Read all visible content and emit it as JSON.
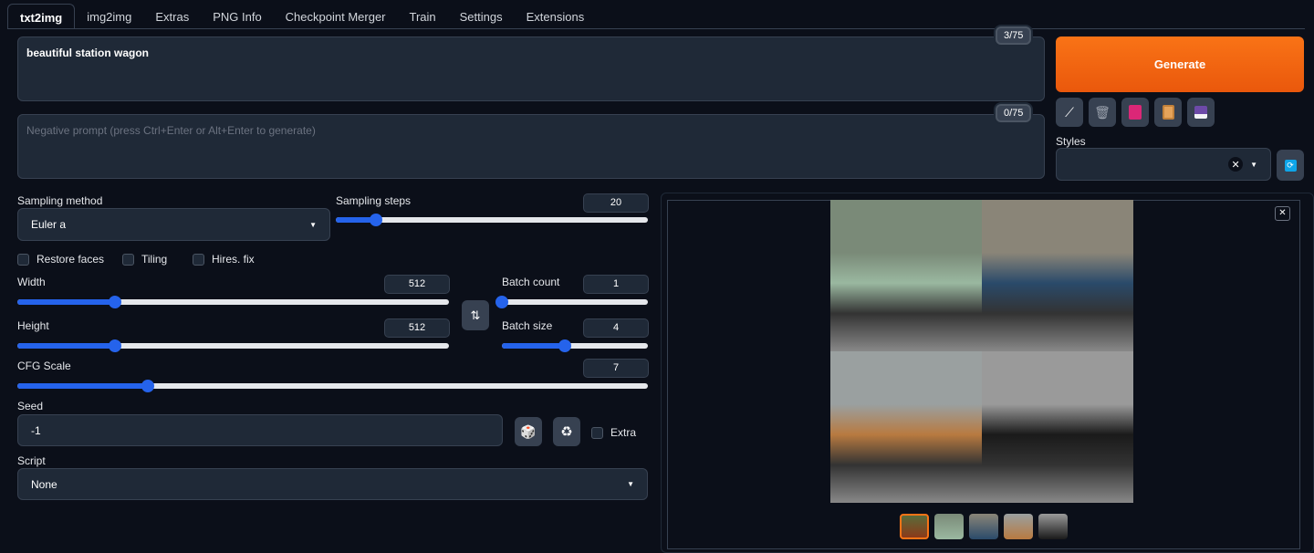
{
  "tabs": [
    "txt2img",
    "img2img",
    "Extras",
    "PNG Info",
    "Checkpoint Merger",
    "Train",
    "Settings",
    "Extensions"
  ],
  "prompt": {
    "value": "beautiful station wagon",
    "counter": "3/75"
  },
  "negative_prompt": {
    "placeholder": "Negative prompt (press Ctrl+Enter or Alt+Enter to generate)",
    "counter": "0/75"
  },
  "generate_label": "Generate",
  "tool_buttons": [
    "pencil-icon",
    "trash-icon",
    "picture-icon",
    "clipboard-icon",
    "save-icon"
  ],
  "styles": {
    "label": "Styles",
    "value": ""
  },
  "sampling_method": {
    "label": "Sampling method",
    "value": "Euler a"
  },
  "sampling_steps": {
    "label": "Sampling steps",
    "value": "20",
    "min": 1,
    "max": 150
  },
  "checkboxes": [
    "Restore faces",
    "Tiling",
    "Hires. fix"
  ],
  "width": {
    "label": "Width",
    "value": "512",
    "min": 64,
    "max": 2048
  },
  "height": {
    "label": "Height",
    "value": "512",
    "min": 64,
    "max": 2048
  },
  "batch_count": {
    "label": "Batch count",
    "value": "1",
    "min": 1,
    "max": 100
  },
  "batch_size": {
    "label": "Batch size",
    "value": "4",
    "min": 1,
    "max": 8
  },
  "cfg_scale": {
    "label": "CFG Scale",
    "value": "7",
    "min": 1,
    "max": 30
  },
  "seed": {
    "label": "Seed",
    "value": "-1",
    "extra_label": "Extra"
  },
  "script": {
    "label": "Script",
    "value": "None"
  },
  "gallery": {
    "selected_index": 0,
    "image_colors": [
      [
        "#5a6b3a",
        "#8b3a1a"
      ],
      [
        "#7a8a78",
        "#9ab8a0"
      ],
      [
        "#8a8578",
        "#2a4a6a"
      ],
      [
        "#9aa0a0",
        "#b87a40"
      ],
      [
        "#9a9a9a",
        "#1a1a1a"
      ]
    ]
  }
}
